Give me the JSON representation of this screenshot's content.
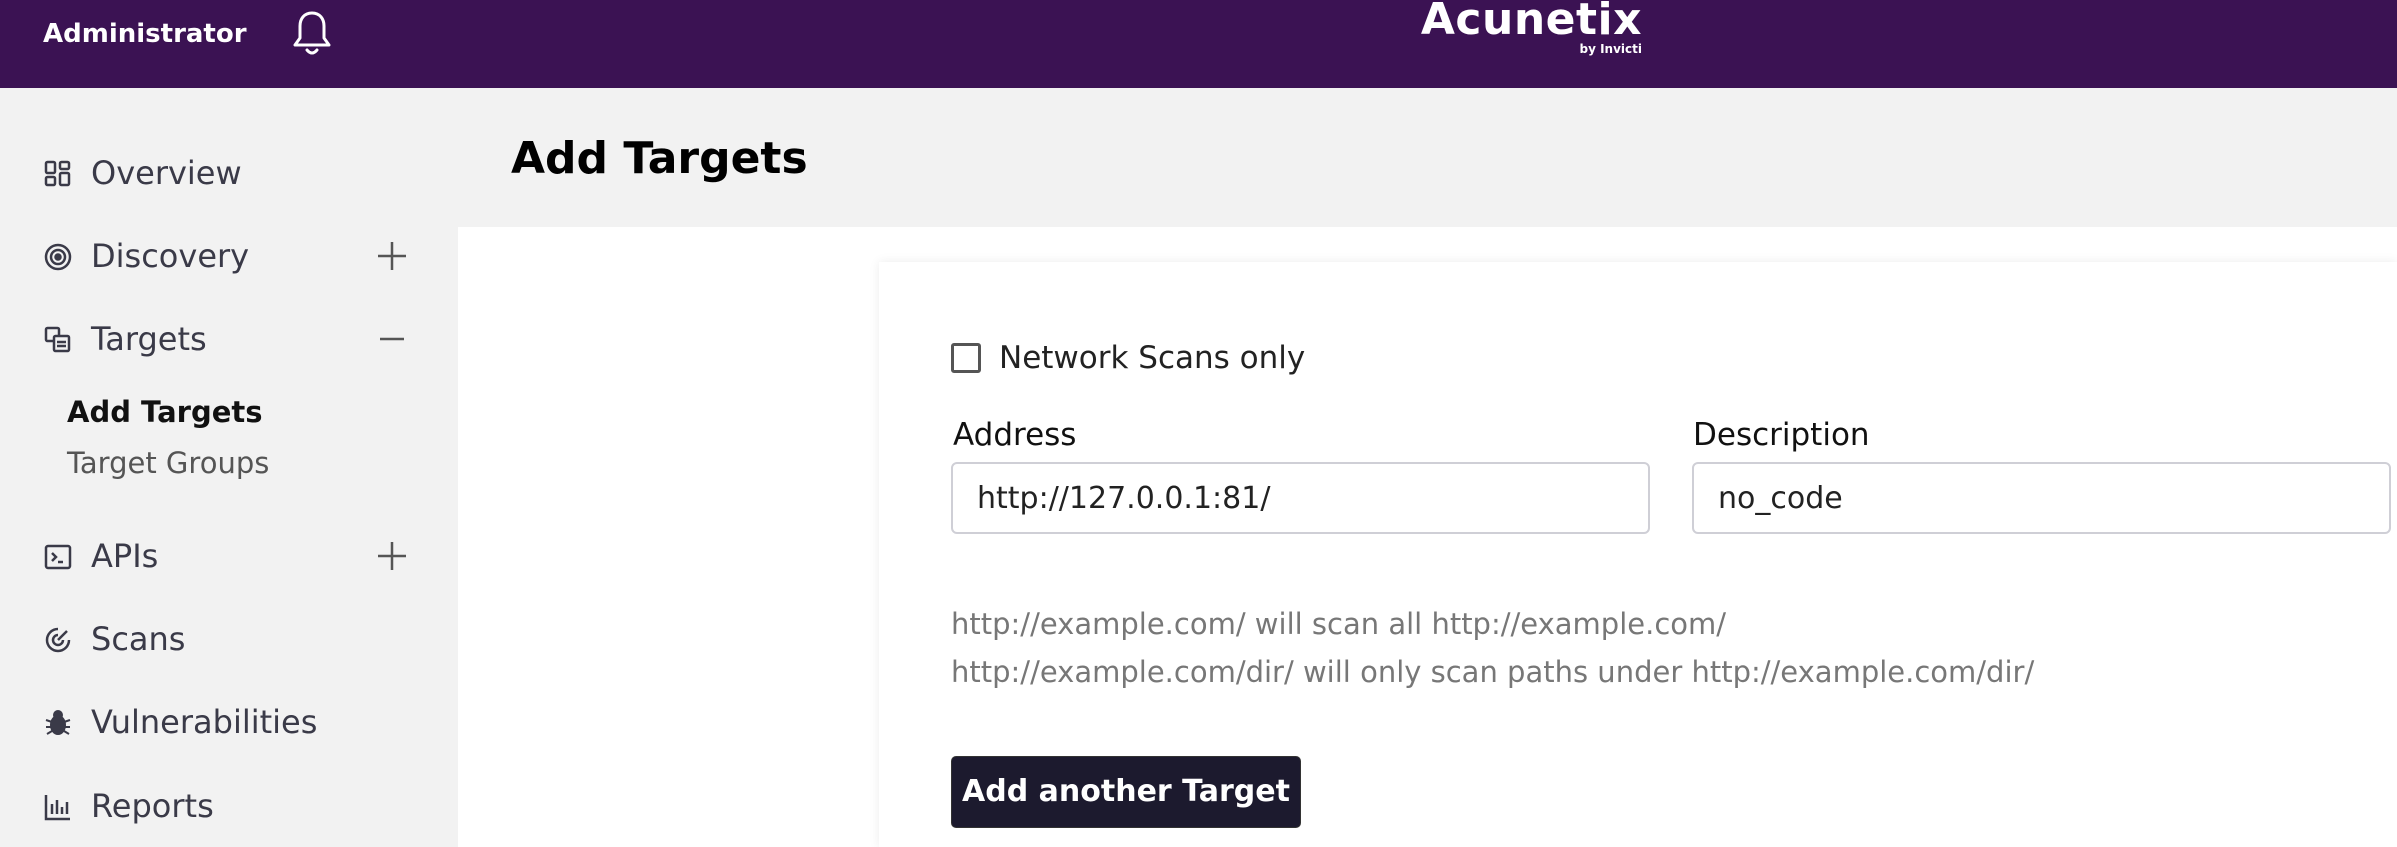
{
  "header": {
    "user": "Administrator",
    "brand_name": "Acunetix",
    "brand_by": "by Invicti",
    "colors": {
      "bar": "#3b1253"
    }
  },
  "sidebar": {
    "items": [
      {
        "label": "Overview",
        "icon": "dashboard-grid-icon",
        "action": ""
      },
      {
        "label": "Discovery",
        "icon": "target-circle-icon",
        "action": "plus-icon"
      },
      {
        "label": "Targets",
        "icon": "targets-stack-icon",
        "action": "minus-icon"
      },
      {
        "label": "APIs",
        "icon": "terminal-icon",
        "action": "plus-icon"
      },
      {
        "label": "Scans",
        "icon": "scan-radar-icon",
        "action": ""
      },
      {
        "label": "Vulnerabilities",
        "icon": "bug-icon",
        "action": ""
      },
      {
        "label": "Reports",
        "icon": "bar-chart-icon",
        "action": ""
      }
    ],
    "sub_items": [
      {
        "label": "Add Targets",
        "active": true
      },
      {
        "label": "Target Groups",
        "active": false
      }
    ]
  },
  "page": {
    "title": "Add Targets"
  },
  "form": {
    "network_scans_label": "Network Scans only",
    "network_scans_checked": false,
    "address_label": "Address",
    "address_value": "http://127.0.0.1:81/",
    "description_label": "Description",
    "description_value": "no_code",
    "hint_line_1": "http://example.com/ will scan all http://example.com/",
    "hint_line_2": "http://example.com/dir/ will only scan paths under http://example.com/dir/",
    "add_button": "Add another Target"
  }
}
